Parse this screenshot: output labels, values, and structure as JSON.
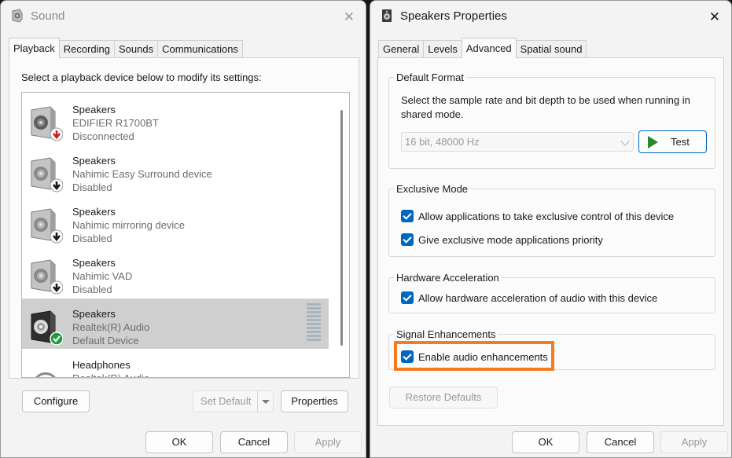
{
  "sound_window": {
    "title": "Sound",
    "tabs": [
      {
        "label": "Playback",
        "active": true
      },
      {
        "label": "Recording",
        "active": false
      },
      {
        "label": "Sounds",
        "active": false
      },
      {
        "label": "Communications",
        "active": false
      }
    ],
    "instruction": "Select a playback device below to modify its settings:",
    "devices": [
      {
        "name": "Speakers",
        "device": "EDIFIER R1700BT",
        "status": "Disconnected",
        "icon": "speaker-disconnected-icon",
        "badge_color": "#cc1e1e",
        "selected": false
      },
      {
        "name": "Speakers",
        "device": "Nahimic Easy Surround device",
        "status": "Disabled",
        "icon": "speaker-disabled-icon",
        "badge_color": "#1a1a1a",
        "selected": false
      },
      {
        "name": "Speakers",
        "device": "Nahimic mirroring device",
        "status": "Disabled",
        "icon": "speaker-disabled-icon",
        "badge_color": "#1a1a1a",
        "selected": false
      },
      {
        "name": "Speakers",
        "device": "Nahimic VAD",
        "status": "Disabled",
        "icon": "speaker-disabled-icon",
        "badge_color": "#1a1a1a",
        "selected": false
      },
      {
        "name": "Speakers",
        "device": "Realtek(R) Audio",
        "status": "Default Device",
        "icon": "speaker-default-icon",
        "badge_color": "#1e9e3a",
        "selected": true
      },
      {
        "name": "Headphones",
        "device": "Realtek(R) Audio",
        "status": "",
        "icon": "headphones-icon",
        "selected": false
      }
    ],
    "buttons": {
      "configure": "Configure",
      "set_default": "Set Default",
      "properties": "Properties",
      "ok": "OK",
      "cancel": "Cancel",
      "apply": "Apply"
    }
  },
  "props_window": {
    "title": "Speakers Properties",
    "tabs": [
      {
        "label": "General",
        "active": false
      },
      {
        "label": "Levels",
        "active": false
      },
      {
        "label": "Advanced",
        "active": true
      },
      {
        "label": "Spatial sound",
        "active": false
      }
    ],
    "default_format": {
      "label": "Default Format",
      "description": "Select the sample rate and bit depth to be used when running in shared mode.",
      "selected_format": "16 bit, 48000 Hz",
      "test_button": "Test"
    },
    "exclusive_mode": {
      "label": "Exclusive Mode",
      "options": [
        {
          "label": "Allow applications to take exclusive control of this device",
          "checked": true
        },
        {
          "label": "Give exclusive mode applications priority",
          "checked": true
        }
      ]
    },
    "hardware_acceleration": {
      "label": "Hardware Acceleration",
      "option": {
        "label": "Allow hardware acceleration of audio with this device",
        "checked": true
      }
    },
    "signal_enhancements": {
      "label": "Signal Enhancements",
      "option": {
        "label": "Enable audio enhancements",
        "checked": true
      },
      "highlight_color": "#f47c20"
    },
    "buttons": {
      "restore_defaults": "Restore Defaults",
      "ok": "OK",
      "cancel": "Cancel",
      "apply": "Apply"
    }
  },
  "colors": {
    "accent": "#0067c0",
    "selected_row": "#cfcfcf",
    "test_play": "#2a8a2a"
  }
}
